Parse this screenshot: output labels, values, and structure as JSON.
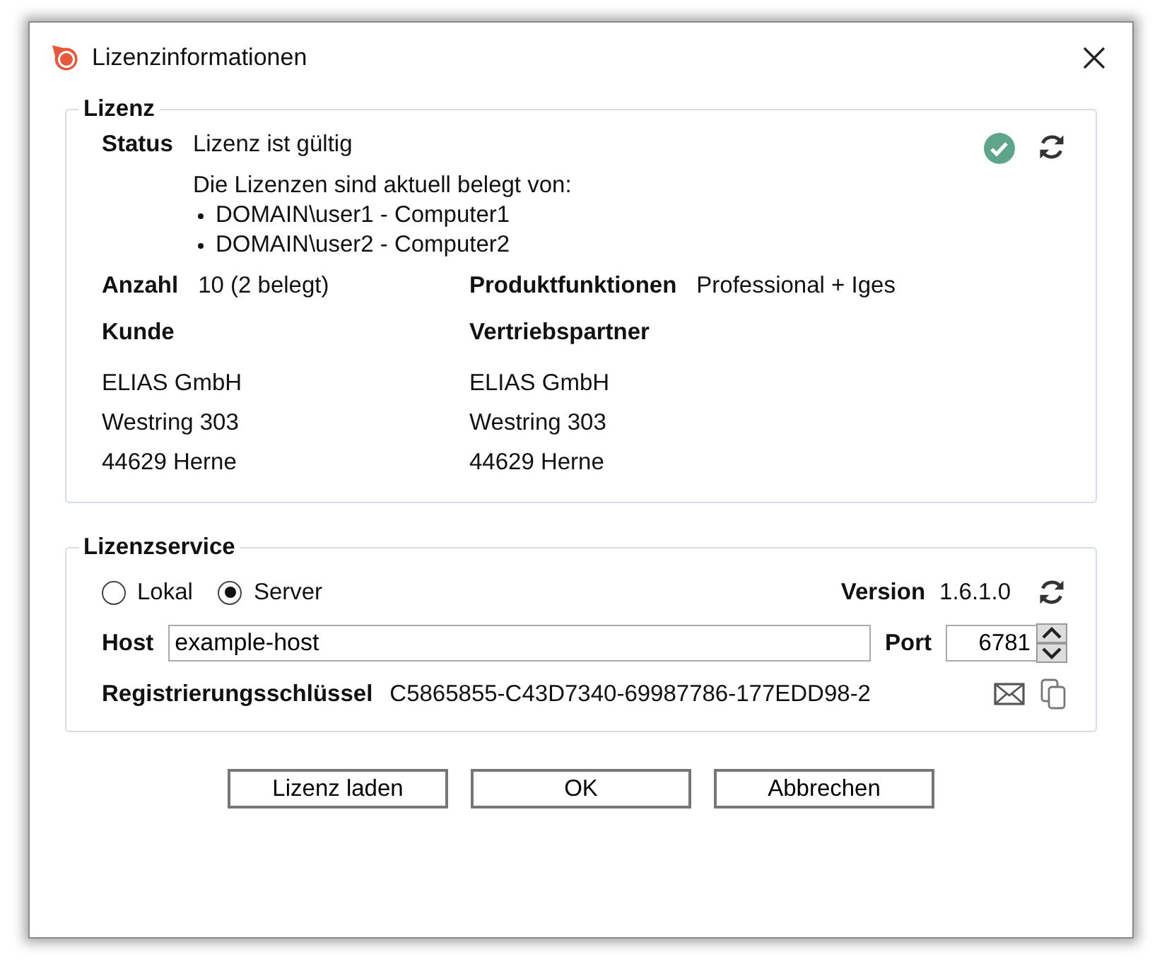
{
  "window": {
    "title": "Lizenzinformationen"
  },
  "license": {
    "legend": "Lizenz",
    "status_label": "Status",
    "status": "Lizenz ist gültig",
    "holders_intro": "Die Lizenzen sind aktuell belegt von:",
    "holders": [
      "DOMAIN\\user1 - Computer1",
      "DOMAIN\\user2 - Computer2"
    ],
    "count_label": "Anzahl",
    "count": "10 (2 belegt)",
    "features_label": "Produktfunktionen",
    "features": "Professional + Iges",
    "customer": {
      "label": "Kunde",
      "lines": [
        "ELIAS GmbH",
        "Westring 303",
        "44629 Herne"
      ]
    },
    "partner": {
      "label": "Vertriebspartner",
      "lines": [
        "ELIAS GmbH",
        "Westring 303",
        "44629 Herne"
      ]
    }
  },
  "service": {
    "legend": "Lizenzservice",
    "modes": [
      {
        "label": "Lokal",
        "selected": false
      },
      {
        "label": "Server",
        "selected": true
      }
    ],
    "version_label": "Version",
    "version": "1.6.1.0",
    "host_label": "Host",
    "host": "example-host",
    "port_label": "Port",
    "port": "6781",
    "key_label": "Registrierungsschlüssel",
    "key": "C5865855-C43D7340-69987786-177EDD98-2"
  },
  "buttons": [
    "Lizenz laden",
    "OK",
    "Abbrechen"
  ]
}
